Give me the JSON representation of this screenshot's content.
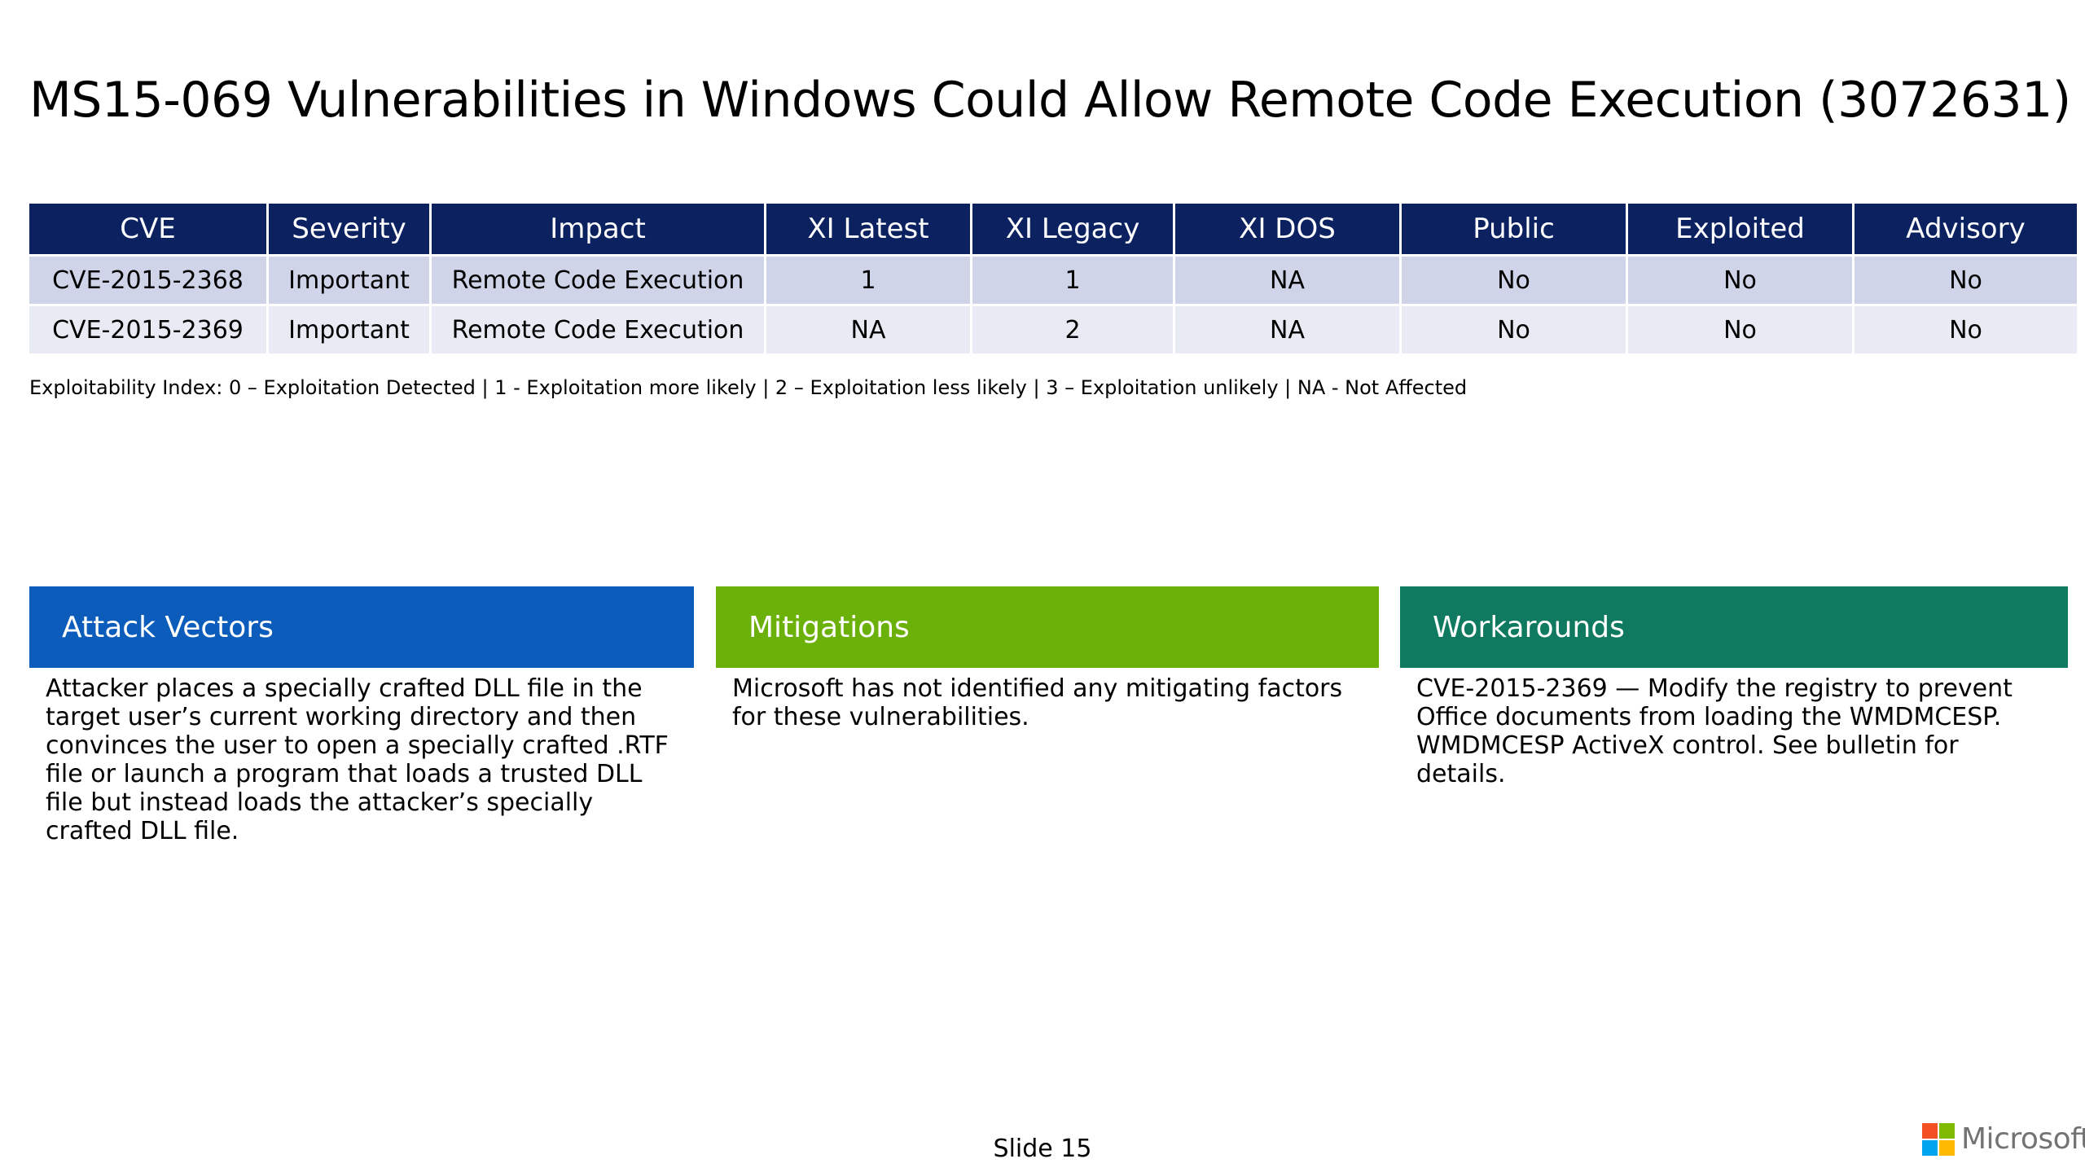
{
  "title": "MS15-069 Vulnerabilities in Windows Could Allow Remote Code Execution (3072631)",
  "table": {
    "headers": [
      "CVE",
      "Severity",
      "Impact",
      "XI Latest",
      "XI Legacy",
      "XI DOS",
      "Public",
      "Exploited",
      "Advisory"
    ],
    "rows": [
      [
        "CVE-2015-2368",
        "Important",
        "Remote Code Execution",
        "1",
        "1",
        "NA",
        "No",
        "No",
        "No"
      ],
      [
        "CVE-2015-2369",
        "Important",
        "Remote Code Execution",
        "NA",
        "2",
        "NA",
        "No",
        "No",
        "No"
      ]
    ]
  },
  "index_note": "Exploitability Index: 0 – Exploitation Detected | 1 - Exploitation more likely  | 2 – Exploitation less likely  | 3 – Exploitation unlikely | NA - Not Affected",
  "panels": [
    {
      "title": "Attack Vectors",
      "body": "Attacker places a specially crafted DLL file in the target user’s current working directory and then convinces the user to open a specially crafted .RTF file or launch a program that loads a trusted DLL file but instead loads the attacker’s specially crafted DLL file.",
      "color": "#0c5cbc"
    },
    {
      "title": "Mitigations",
      "body": "Microsoft has not identified any  mitigating factors for these vulnerabilities.",
      "color": "#6cb00a"
    },
    {
      "title": "Workarounds",
      "body": "CVE-2015-2369 — Modify the registry to prevent Office documents from loading the WMDMCESP. WMDMCESP ActiveX control. See bulletin for details.",
      "color": "#0f7a5f"
    }
  ],
  "footer": {
    "slide_label": "Slide 15",
    "logo_text": "Microsoft",
    "logo_icon": "microsoft-logo-icon",
    "logo_colors": [
      "#f25022",
      "#7fba00",
      "#00a4ef",
      "#ffb900"
    ]
  },
  "colors": {
    "table_header": "#0b2160",
    "row_odd": "#cfd4e9",
    "row_even": "#e8ebf3"
  }
}
